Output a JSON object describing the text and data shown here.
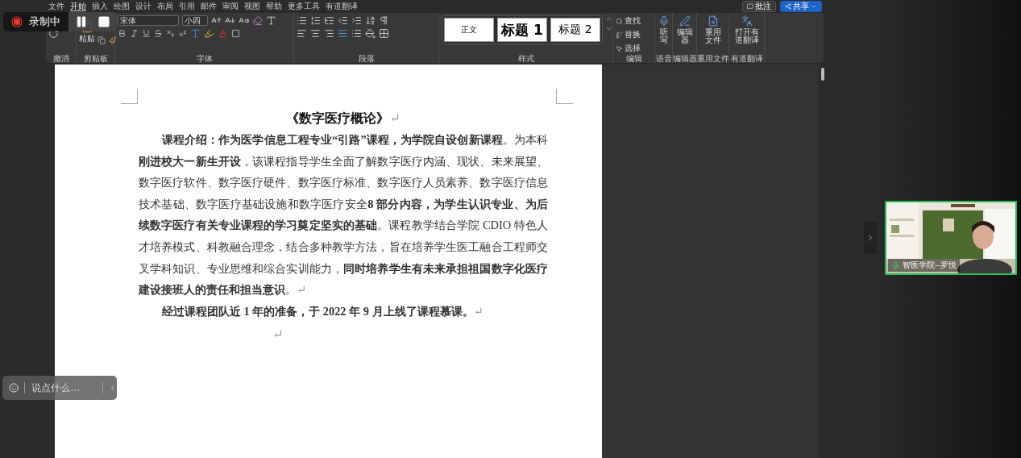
{
  "menu_tabs": [
    {
      "label": "文件",
      "selected": false
    },
    {
      "label": "开始",
      "selected": true
    },
    {
      "label": "插入",
      "selected": false
    },
    {
      "label": "绘图",
      "selected": false
    },
    {
      "label": "设计",
      "selected": false
    },
    {
      "label": "布局",
      "selected": false
    },
    {
      "label": "引用",
      "selected": false
    },
    {
      "label": "邮件",
      "selected": false
    },
    {
      "label": "审阅",
      "selected": false
    },
    {
      "label": "视图",
      "selected": false
    },
    {
      "label": "帮助",
      "selected": false
    },
    {
      "label": "更多工具",
      "selected": false
    },
    {
      "label": "有道翻译",
      "selected": false
    }
  ],
  "top_buttons": [
    {
      "label": "批注",
      "kind": "comment"
    },
    {
      "label": "共享",
      "kind": "share"
    }
  ],
  "ribbon": {
    "undo": {
      "label": "撤消"
    },
    "clipboard": {
      "label": "剪贴板",
      "paste": "粘贴"
    },
    "font": {
      "label": "字体",
      "font_name": "宋体",
      "font_size": "小四"
    },
    "paragraph": {
      "label": "段落"
    },
    "styles": {
      "label": "样式",
      "items": [
        {
          "label": "正文",
          "kind": "normal"
        },
        {
          "label": "标题 1",
          "kind": "h1"
        },
        {
          "label": "标题 2",
          "kind": "h2"
        }
      ]
    },
    "editing": {
      "label": "编辑",
      "items": [
        {
          "label": "查找",
          "kind": "find"
        },
        {
          "label": "替换",
          "kind": "replace"
        },
        {
          "label": "选择",
          "kind": "select"
        }
      ]
    },
    "tools": [
      {
        "label": "语音",
        "button": "听写",
        "kind": "dictate"
      },
      {
        "label": "编辑器",
        "button": "编辑器",
        "kind": "editor"
      },
      {
        "label": "重用文件",
        "button": "重用文件",
        "kind": "reuse"
      },
      {
        "label": "有道翻译",
        "button": "打开有道翻译",
        "kind": "translate"
      }
    ]
  },
  "document": {
    "title": "《数字医疗概论》",
    "title_mark": "↵",
    "paragraphs": [
      {
        "text": "**课程介绍：作为医学信息工程专业“引路”课程，为学院自设创新课程**。为本科**刚进校大一新生开设**，该课程指导学生全面了解数字医疗内涵、现状、未来展望、数字医疗软件、数字医疗硬件、数字医疗标准、数字医疗人员素养、数字医疗信息技术基础、数字医疗基础设施和数字医疗安全**8 部分内容，为学生认识专业、为后续数字医疗有关专业课程的学习奠定坚实的基础**。课程教学结合学院 CDIO 特色人才培养模式、科教融合理念，结合多种教学方法，旨在培养学生医工融合工程师交叉学科知识、专业思维和综合实训能力，**同时培养学生有未来承担祖国数字化医疗建设接班人的责任和担当意识**。",
        "mark": "↵"
      },
      {
        "text": "**经过课程团队近 1 年的准备，于 2022 年 9 月上线了课程慕课。**",
        "mark": "↵"
      }
    ],
    "empty_mark": "↵"
  },
  "recording": {
    "label": "录制中"
  },
  "chat": {
    "placeholder": "说点什么..."
  },
  "video": {
    "name": "智医学院--罗悦",
    "mic_on": true,
    "kind": "picture"
  }
}
